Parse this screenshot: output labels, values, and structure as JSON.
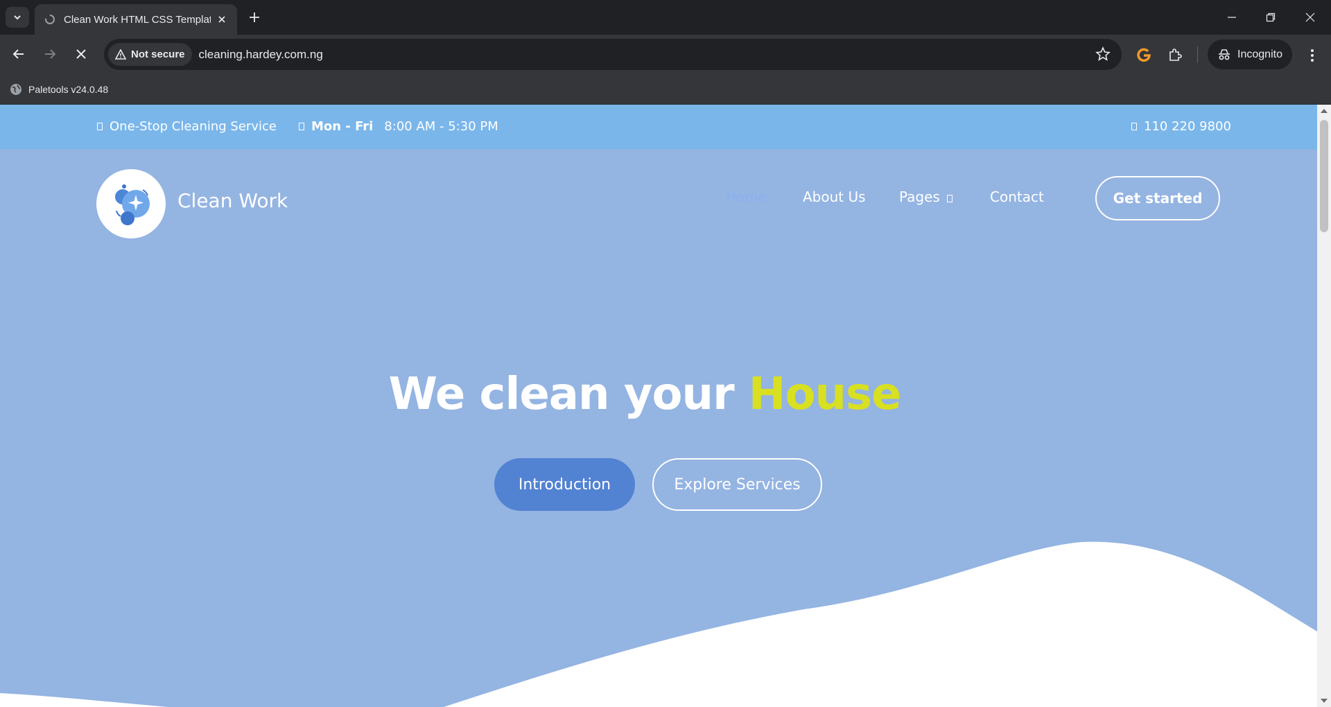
{
  "browser": {
    "tab_title": "Clean Work HTML CSS Template",
    "url": "cleaning.hardey.com.ng",
    "security_label": "Not secure",
    "profile_label": "Incognito",
    "bookmark_label": "Paletools v24.0.48"
  },
  "topbar": {
    "tagline": "One-Stop Cleaning Service",
    "days": "Mon - Fri",
    "hours": "8:00 AM - 5:30 PM",
    "phone": "110 220 9800"
  },
  "header": {
    "brand": "Clean Work",
    "nav": [
      "Home",
      "About Us",
      "Pages",
      "Contact"
    ],
    "cta": "Get started"
  },
  "hero": {
    "title_main": "We clean your",
    "title_highlight": "House",
    "btn_primary": "Introduction",
    "btn_secondary": "Explore Services"
  },
  "colors": {
    "hero_bg": "#94b4e2",
    "topbar_bg": "#7ab6ea",
    "highlight": "#d8e021",
    "primary_btn": "#5282d2"
  }
}
